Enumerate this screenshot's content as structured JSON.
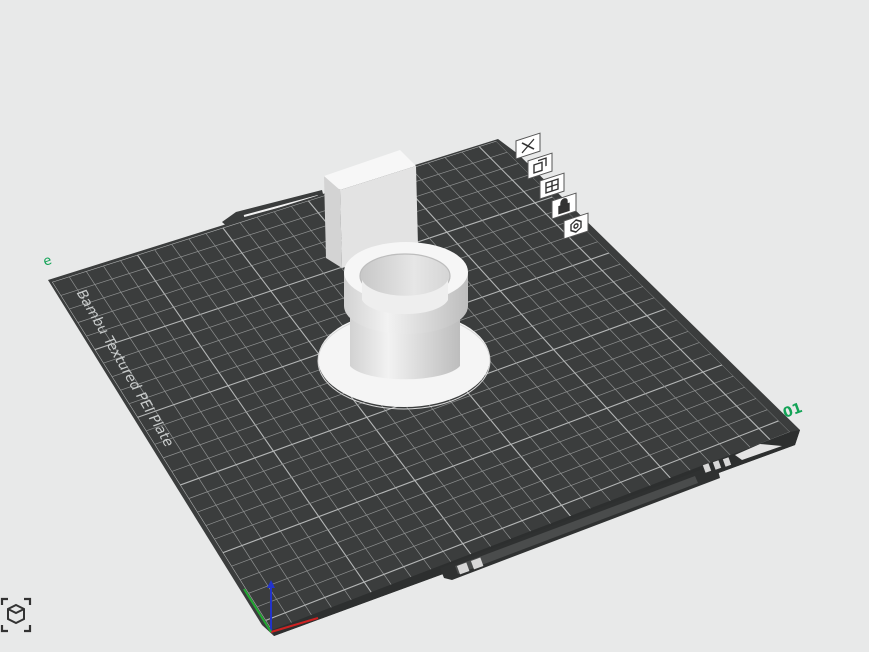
{
  "plate": {
    "name": "Bambu Textured PEI Plate",
    "label_left": "e",
    "label_right": "01"
  },
  "toolbar": {
    "buttons": [
      {
        "id": "delete",
        "icon": "close-icon"
      },
      {
        "id": "copy",
        "icon": "copy-icon"
      },
      {
        "id": "arrange",
        "icon": "arrange-icon"
      },
      {
        "id": "lock",
        "icon": "lock-icon"
      },
      {
        "id": "settings",
        "icon": "gear-icon"
      }
    ]
  },
  "colors": {
    "background": "#e8e9e9",
    "plate": "#3b3d3d",
    "grid": "#8e9090",
    "plate_label": "#c9cccc",
    "plate_accent": "#12a356",
    "model": "#e6e6e6"
  },
  "view_cube": {
    "icon": "view-cube-icon"
  }
}
